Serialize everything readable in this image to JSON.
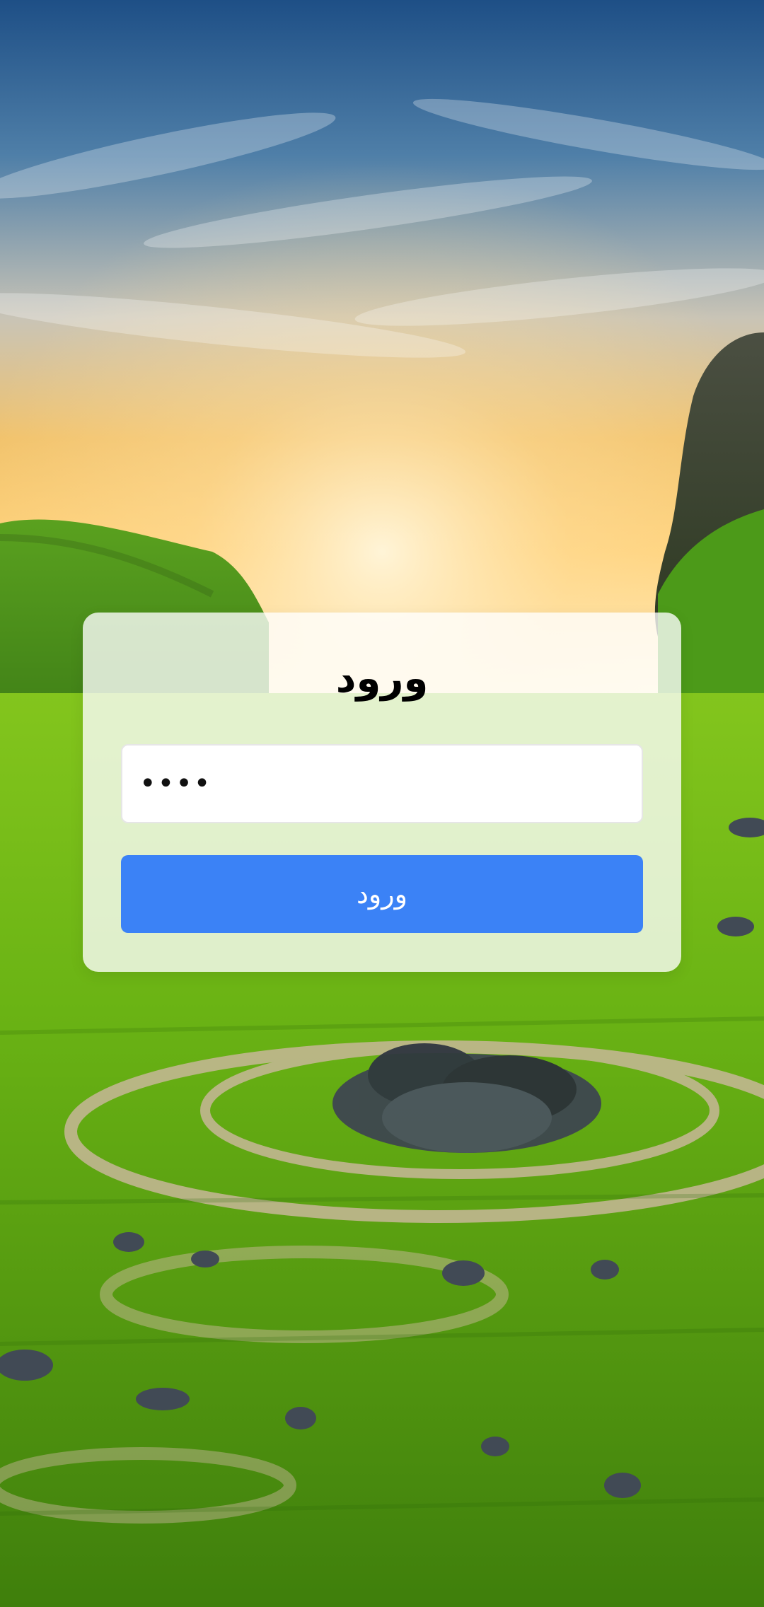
{
  "login": {
    "title": "ورود",
    "password_value": "1234",
    "submit_label": "ورود"
  },
  "colors": {
    "button": "#3b82f6",
    "card": "#ffffff",
    "text": "#000000"
  }
}
